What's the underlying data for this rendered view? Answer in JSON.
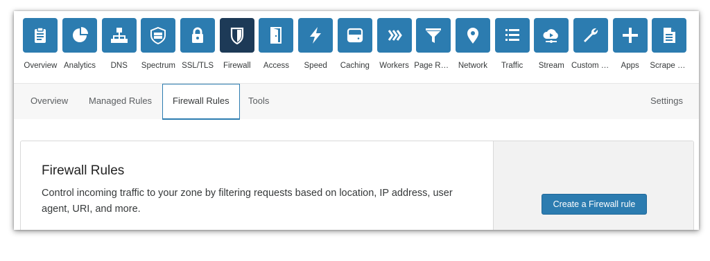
{
  "toolbar": {
    "items": [
      {
        "label": "Overview",
        "icon": "clipboard-icon"
      },
      {
        "label": "Analytics",
        "icon": "pie-chart-icon"
      },
      {
        "label": "DNS",
        "icon": "network-tree-icon"
      },
      {
        "label": "Spectrum",
        "icon": "shield-server-icon"
      },
      {
        "label": "SSL/TLS",
        "icon": "lock-icon"
      },
      {
        "label": "Firewall",
        "icon": "shield-icon",
        "active": true
      },
      {
        "label": "Access",
        "icon": "door-icon"
      },
      {
        "label": "Speed",
        "icon": "lightning-icon"
      },
      {
        "label": "Caching",
        "icon": "server-icon"
      },
      {
        "label": "Workers",
        "icon": "workers-chevrons-icon"
      },
      {
        "label": "Page Rules",
        "icon": "funnel-icon"
      },
      {
        "label": "Network",
        "icon": "location-pin-icon"
      },
      {
        "label": "Traffic",
        "icon": "list-icon"
      },
      {
        "label": "Stream",
        "icon": "cloud-play-icon"
      },
      {
        "label": "Custom Pa...",
        "icon": "wrench-icon"
      },
      {
        "label": "Apps",
        "icon": "plus-icon"
      },
      {
        "label": "Scrape Shi...",
        "icon": "document-icon"
      }
    ]
  },
  "subnav": {
    "tabs": [
      "Overview",
      "Managed Rules",
      "Firewall Rules",
      "Tools"
    ],
    "active_tab": "Firewall Rules",
    "settings_label": "Settings"
  },
  "card": {
    "title": "Firewall Rules",
    "description": "Control incoming traffic to your zone by filtering requests based on location, IP address, user agent, URI, and more.",
    "button_label": "Create a Firewall rule"
  },
  "colors": {
    "tile": "#2c7cb0",
    "tile_active": "#1d3a57",
    "button": "#2c7cb0"
  }
}
